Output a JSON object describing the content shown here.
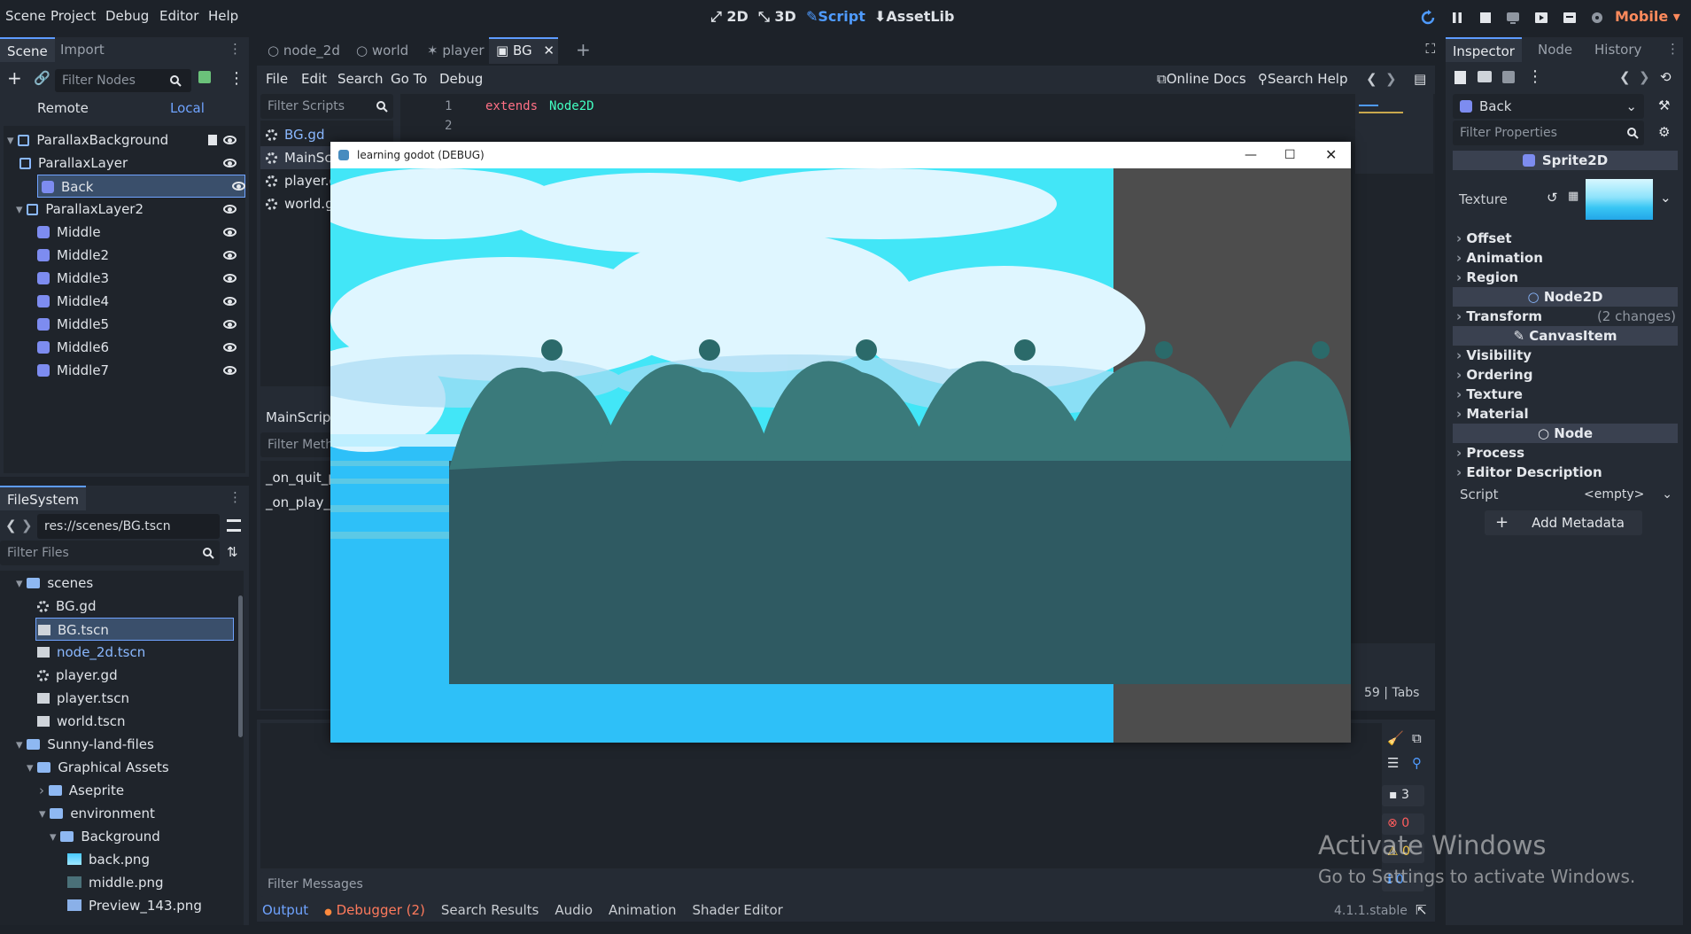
{
  "menu": [
    "Scene",
    "Project",
    "Debug",
    "Editor",
    "Help"
  ],
  "workspaces": {
    "w2d": "2D",
    "w3d": "3D",
    "script": "Script",
    "assetlib": "AssetLib"
  },
  "renderer": "Mobile",
  "scene_panel": {
    "tabs": [
      "Scene",
      "Import"
    ],
    "filter_placeholder": "Filter Nodes",
    "remote": "Remote",
    "local": "Local",
    "nodes": [
      "ParallaxBackground",
      "ParallaxLayer",
      "Back",
      "ParallaxLayer2",
      "Middle",
      "Middle2",
      "Middle3",
      "Middle4",
      "Middle5",
      "Middle6",
      "Middle7"
    ]
  },
  "filesystem": {
    "tab": "FileSystem",
    "path": "res://scenes/BG.tscn",
    "filter_placeholder": "Filter Files",
    "items": [
      "scenes",
      "BG.gd",
      "BG.tscn",
      "node_2d.tscn",
      "player.gd",
      "player.tscn",
      "world.tscn",
      "Sunny-land-files",
      "Graphical Assets",
      "Aseprite",
      "environment",
      "Background",
      "back.png",
      "middle.png",
      "Preview_143.png"
    ]
  },
  "editor_tabs": [
    "node_2d",
    "world",
    "player",
    "BG"
  ],
  "script_menu": [
    "File",
    "Edit",
    "Search",
    "Go To",
    "Debug"
  ],
  "online_docs": "Online Docs",
  "search_help": "Search Help",
  "filter_scripts": "Filter Scripts",
  "scripts": [
    "BG.gd",
    "MainScr",
    "player.g",
    "world.gd"
  ],
  "main_script_label": "MainScript.",
  "filter_methods": "Filter Meth",
  "methods": [
    "_on_quit_pr",
    "_on_play_pr"
  ],
  "code": {
    "line1_no": "1",
    "line1_kw": "extends",
    "line1_type": "Node2D",
    "line2_no": "2"
  },
  "status_line": "59",
  "status_sep": "|",
  "status_tabs": "Tabs",
  "debug_counts": {
    "messages": "3",
    "errors": "0",
    "warnings": "0",
    "other": "0"
  },
  "filter_messages": "Filter Messages",
  "bottom_tabs": [
    "Output",
    "Debugger (2)",
    "Search Results",
    "Audio",
    "Animation",
    "Shader Editor"
  ],
  "version": "4.1.1.stable",
  "inspector": {
    "tabs": [
      "Inspector",
      "Node",
      "History"
    ],
    "node_name": "Back",
    "filter_placeholder": "Filter Properties",
    "class_sprite": "Sprite2D",
    "texture_label": "Texture",
    "sprite_sections": [
      "Offset",
      "Animation",
      "Region"
    ],
    "class_node2d": "Node2D",
    "transform": "Transform",
    "transform_changes": "(2 changes)",
    "class_canvas": "CanvasItem",
    "canvas_sections": [
      "Visibility",
      "Ordering",
      "Texture",
      "Material"
    ],
    "class_node": "Node",
    "node_sections": [
      "Process",
      "Editor Description"
    ],
    "script_label": "Script",
    "script_value": "<empty>",
    "add_metadata": "Add Metadata"
  },
  "game_window": {
    "title": "learning godot (DEBUG)"
  },
  "watermark": {
    "line1": "Activate Windows",
    "line2": "Go to Settings to activate Windows."
  },
  "colors": {
    "accent": "#4f9bff",
    "sky": "#42d9f5",
    "water": "#2ec0f8",
    "ground": "#2f5a62",
    "canvas_gray": "#4d4d4d",
    "error": "#ff5d5d",
    "warning": "#f0c543"
  }
}
